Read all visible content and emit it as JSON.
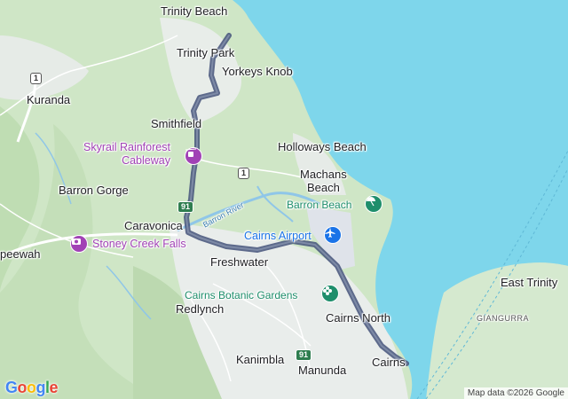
{
  "map": {
    "places": {
      "trinity_beach": "Trinity Beach",
      "trinity_park": "Trinity Park",
      "yorkeys_knob": "Yorkeys Knob",
      "kuranda": "Kuranda",
      "smithfield": "Smithfield",
      "holloways_beach": "Holloways Beach",
      "machans_beach": "Machans\nBeach",
      "barron_gorge": "Barron Gorge",
      "caravonica": "Caravonica",
      "speewah": "peewah",
      "freshwater": "Freshwater",
      "redlynch": "Redlynch",
      "cairns_north": "Cairns North",
      "kanimbla": "Kanimbla",
      "manunda": "Manunda",
      "cairns": "Cairns",
      "east_trinity": "East Trinity",
      "giangurra": "GIANGURRA"
    },
    "pois": {
      "skyrail": "Skyrail Rainforest\nCableway",
      "barron_beach": "Barron Beach",
      "cairns_airport": "Cairns Airport",
      "stoney_creek": "Stoney Creek Falls",
      "botanic_gardens": "Cairns Botanic Gardens"
    },
    "river": "Barron River",
    "shields": {
      "r1_north": "1",
      "r1_mid": "1",
      "r91_top": "91",
      "r91_bottom": "91"
    },
    "icons": {
      "skyrail_icon": "cable-car-icon",
      "barron_beach_icon": "beach-umbrella-icon",
      "airport_icon": "airplane-icon",
      "stoney_creek_icon": "camera-icon",
      "botanic_icon": "flower-icon"
    },
    "colors": {
      "water": "#7ed6eb",
      "land": "#d9ecd3",
      "route": "#5a6b86",
      "urban": "#eef1f3"
    },
    "logo": "Google",
    "attribution": "Map data ©2026 Google"
  }
}
